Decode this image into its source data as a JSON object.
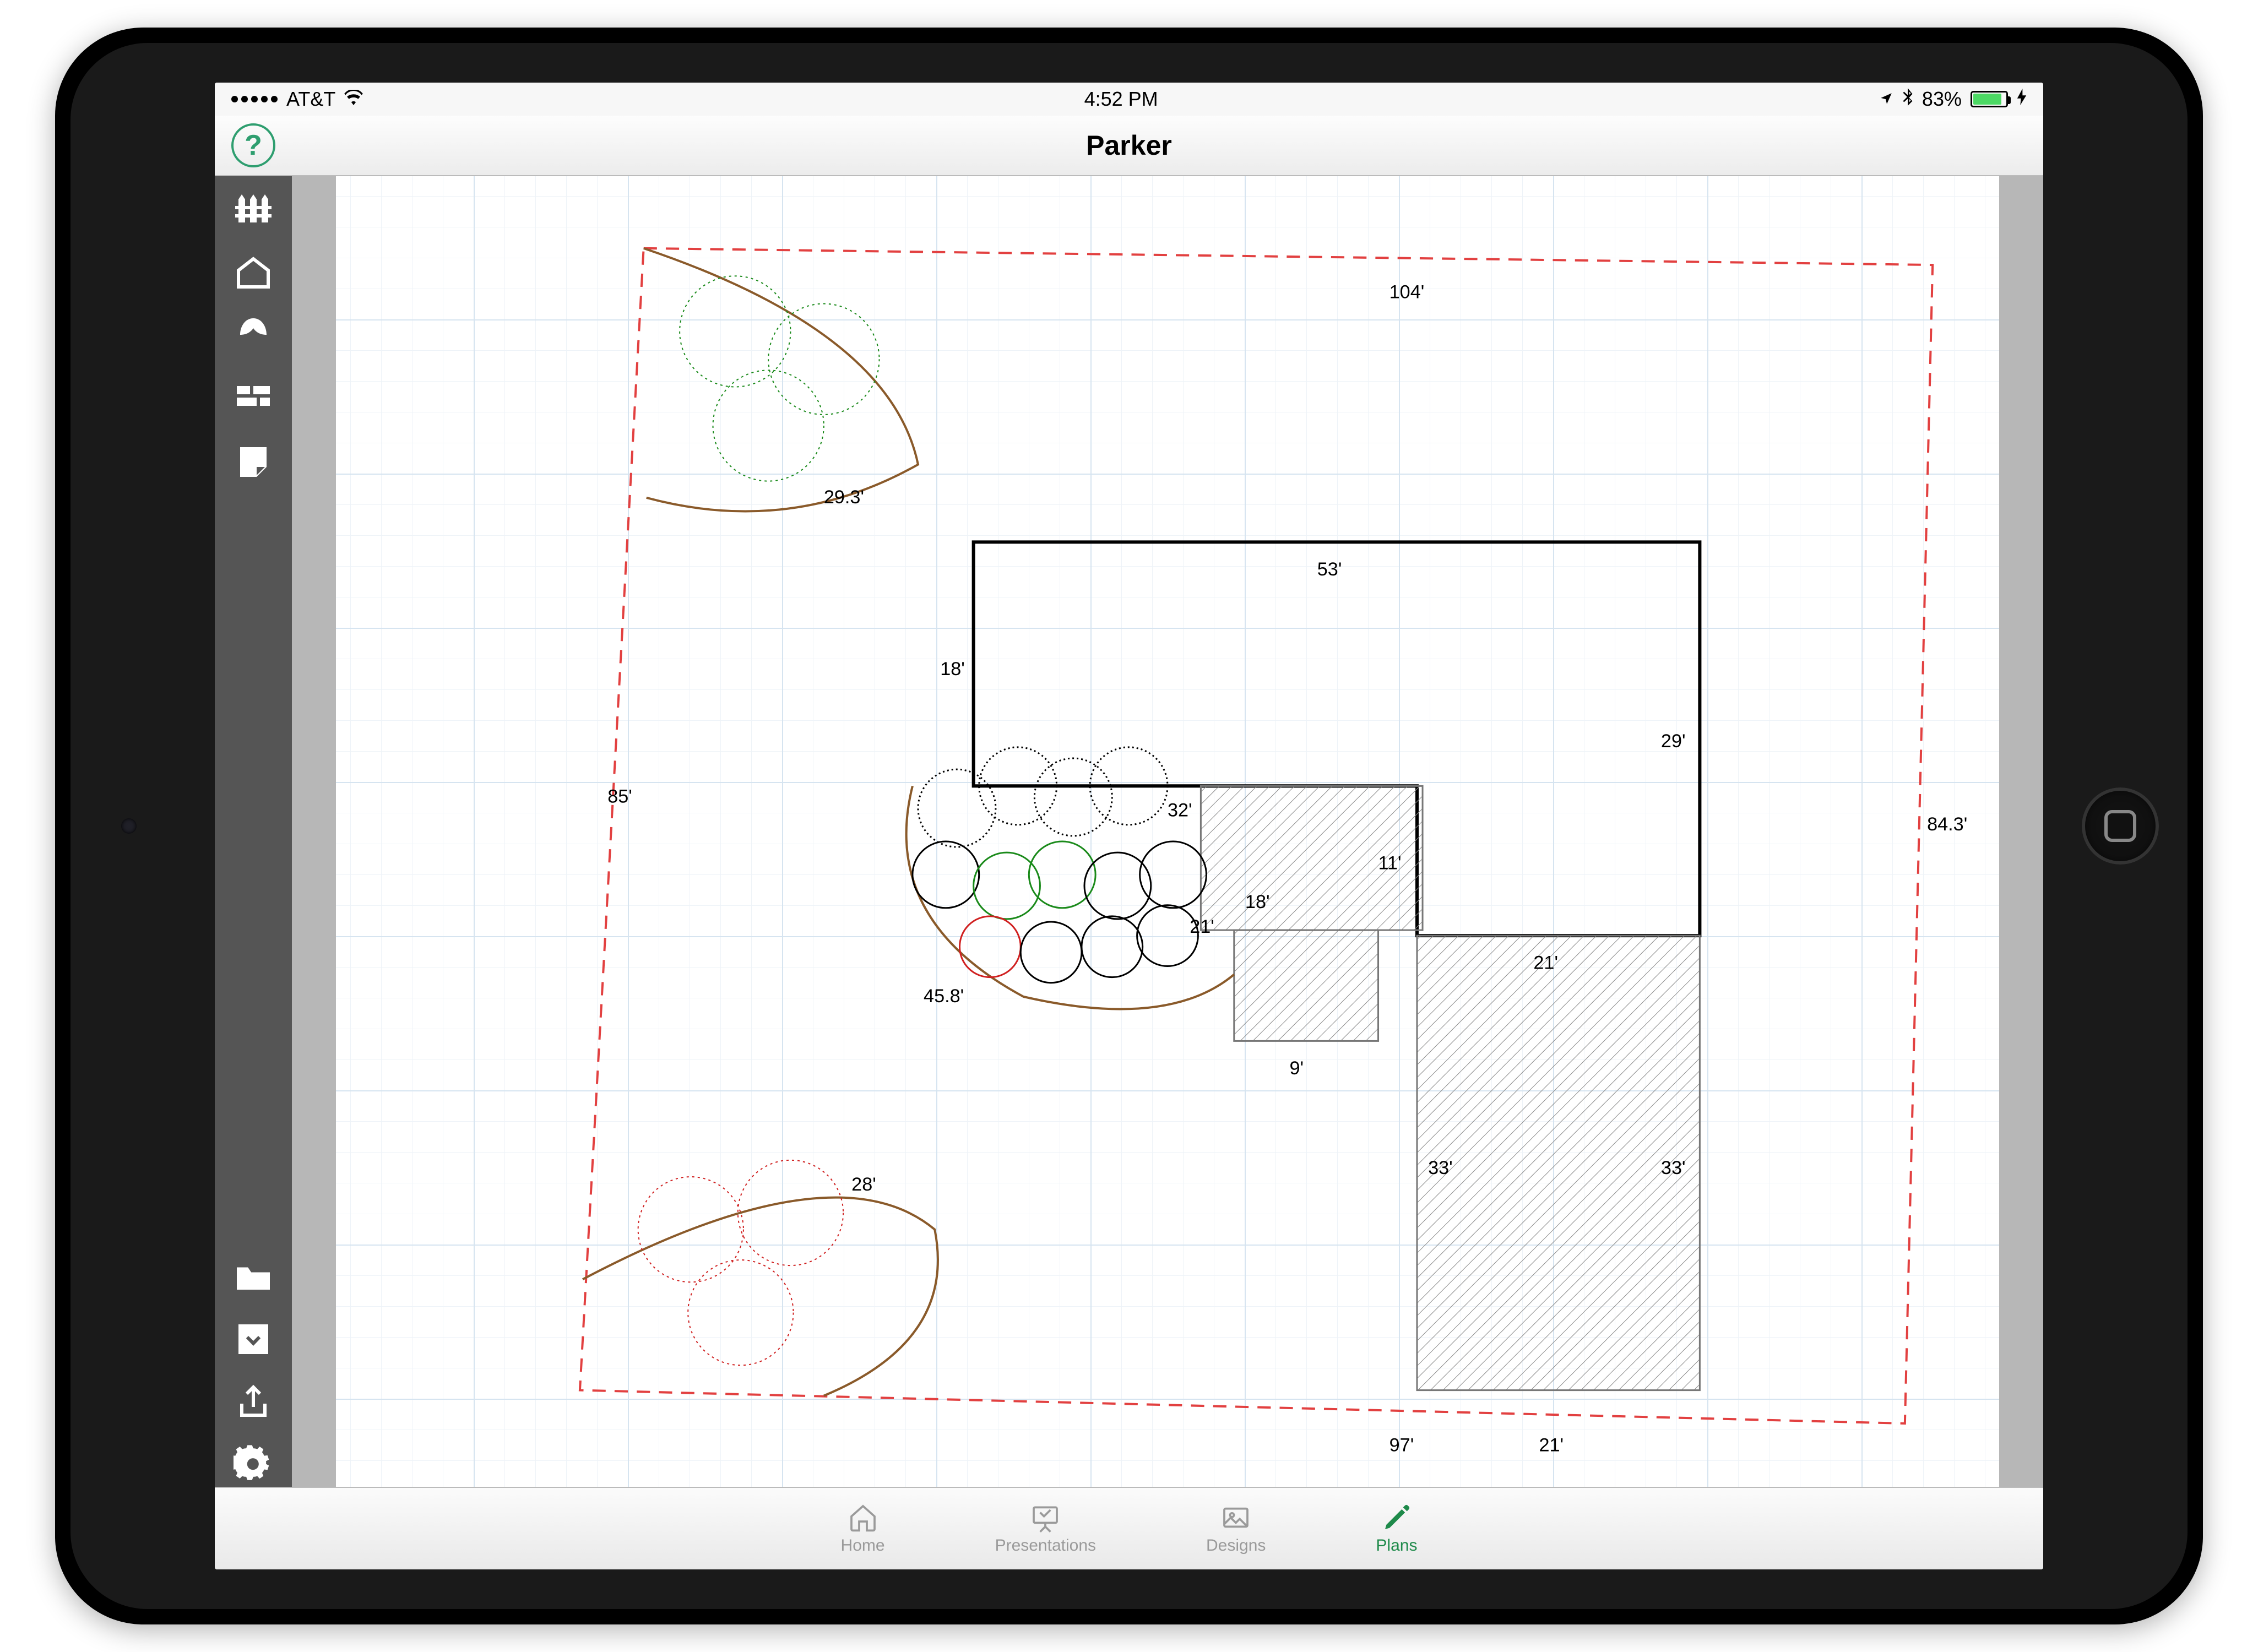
{
  "status": {
    "carrier": "AT&T",
    "time": "4:52 PM",
    "battery_pct": "83%"
  },
  "header": {
    "title": "Parker",
    "help_glyph": "?"
  },
  "sidebar_tools": [
    {
      "id": "fence",
      "name": "fence-tool-icon"
    },
    {
      "id": "structure",
      "name": "structure-tool-icon"
    },
    {
      "id": "plant",
      "name": "plant-tool-icon"
    },
    {
      "id": "hardscape",
      "name": "hardscape-tool-icon"
    },
    {
      "id": "note",
      "name": "note-tool-icon"
    }
  ],
  "sidebar_actions": [
    {
      "id": "open",
      "name": "open-folder-icon"
    },
    {
      "id": "save",
      "name": "save-download-icon"
    },
    {
      "id": "share",
      "name": "share-icon"
    },
    {
      "id": "settings",
      "name": "settings-gear-icon"
    }
  ],
  "dimensions": {
    "lot_top": "104'",
    "lot_left": "85'",
    "lot_right": "84.3'",
    "lot_bottom_a": "97'",
    "lot_bottom_b": "21'",
    "bed_nw": "29.3'",
    "bed_sw": "28'",
    "bed_center": "45.8'",
    "house_top": "53'",
    "house_left": "18'",
    "house_right": "29'",
    "house_step_a": "32'",
    "house_step_b": "11'",
    "house_step_c": "21'",
    "patio_front_w": "21'",
    "patio_left_h": "18'",
    "stair_w": "9'",
    "drive_left_h": "33'",
    "drive_right_h": "33'"
  },
  "tabs": [
    {
      "id": "home",
      "label": "Home",
      "active": false
    },
    {
      "id": "presentations",
      "label": "Presentations",
      "active": false
    },
    {
      "id": "designs",
      "label": "Designs",
      "active": false
    },
    {
      "id": "plans",
      "label": "Plans",
      "active": true
    }
  ],
  "colors": {
    "accent_green": "#1e8a4a",
    "help_green": "#2e9e6f",
    "sidebar": "#555555",
    "lot_dash": "#e24040"
  }
}
